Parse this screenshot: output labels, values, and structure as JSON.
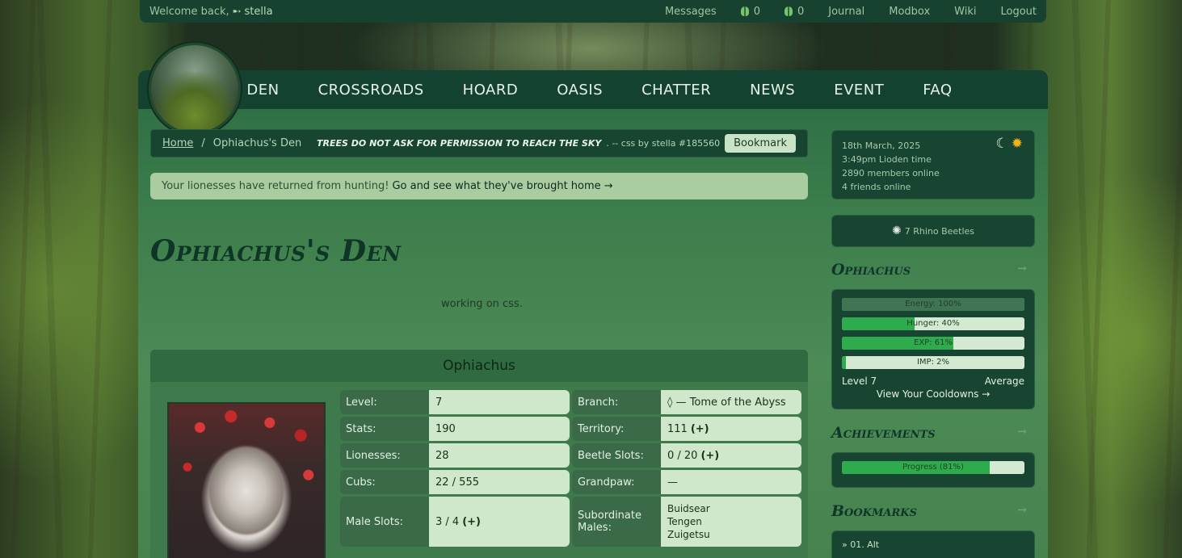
{
  "topbar": {
    "welcome": "Welcome back,",
    "user_icon": "arrow-icon",
    "username": "stella",
    "links": [
      "Messages",
      "Journal",
      "Modbox",
      "Wiki",
      "Logout"
    ],
    "counter1": "0",
    "counter2": "0"
  },
  "nav": {
    "items": [
      "DEN",
      "CROSSROADS",
      "HOARD",
      "OASIS",
      "CHATTER",
      "NEWS",
      "EVENT",
      "FAQ"
    ]
  },
  "breadcrumb": {
    "home": "Home",
    "separator": "/",
    "current": "Ophiachus's Den",
    "quote": "TREES DO NOT ASK FOR PERMISSION TO REACH THE SKY",
    "credit": ". -- css by stella #185560",
    "bookmark_label": "Bookmark"
  },
  "notice": {
    "text": "Your lionesses have returned from hunting!",
    "cta": "Go and see what they've brought home →"
  },
  "den": {
    "title": "Ophiachus's Den",
    "description": "working on css."
  },
  "lion": {
    "name": "Ophiachus",
    "stats": [
      {
        "left_label": "Level:",
        "left_value": "7",
        "right_label": "Branch:",
        "right_value": "◊ — Tome of the Abyss"
      },
      {
        "left_label": "Stats:",
        "left_value": "190",
        "right_label": "Territory:",
        "right_value": "111",
        "right_plus": "(+)"
      },
      {
        "left_label": "Lionesses:",
        "left_value": "28",
        "right_label": "Beetle Slots:",
        "right_value": "0 / 20",
        "right_plus": "(+)"
      },
      {
        "left_label": "Cubs:",
        "left_value": "22 / 555",
        "right_label": "Grandpaw:",
        "right_value": "—"
      },
      {
        "left_label": "Male Slots:",
        "left_value": "3 / 4",
        "left_plus": "(+)",
        "right_label": "Subordinate Males:",
        "right_values": [
          "Buidsear",
          "Tengen",
          "Zuigetsu"
        ]
      }
    ]
  },
  "sidebar": {
    "date": "18th March, 2025",
    "time": "3:49pm Lioden time",
    "members": "2890 members online",
    "friends": "4 friends online",
    "moon_icon": "moon-icon",
    "sun_icon": "sun-icon",
    "beetles": "7 Rhino Beetles",
    "lion_title": "Ophiachus",
    "bars": [
      {
        "label": "Energy: 100%",
        "percent": 100
      },
      {
        "label": "Hunger: 40%",
        "percent": 40
      },
      {
        "label": "EXP: 61%",
        "percent": 61
      },
      {
        "label": "IMP: 2%",
        "percent": 2
      }
    ],
    "level": "Level 7",
    "rank": "Average",
    "cooldowns": "View Your Cooldowns →",
    "achievements_title": "Achievements",
    "achievements_progress": {
      "label": "Progress (81%)",
      "percent": 81
    },
    "bookmarks_title": "Bookmarks",
    "bookmark_first": "» 01. Alt"
  }
}
